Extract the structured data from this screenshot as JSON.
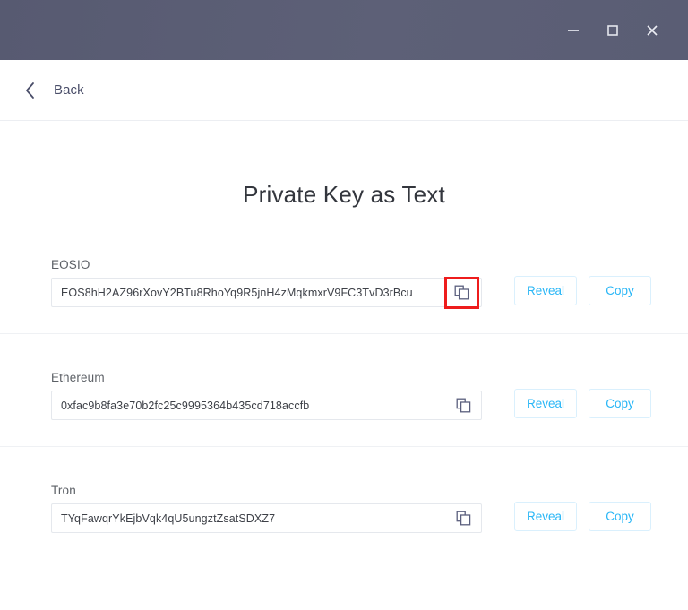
{
  "window": {
    "titlebar_color": "#5a5d74",
    "controls": [
      {
        "name": "minimize",
        "glyph": "minimize-icon"
      },
      {
        "name": "maximize",
        "glyph": "maximize-icon"
      },
      {
        "name": "close",
        "glyph": "close-icon"
      }
    ]
  },
  "nav": {
    "back_label": "Back",
    "back_icon": "chevron-left-icon"
  },
  "page": {
    "title": "Private Key as Text"
  },
  "accent": {
    "link_blue": "#29b6f6",
    "button_border": "#daf0fd",
    "highlight_red": "#ee1c1c"
  },
  "buttons": {
    "reveal_label": "Reveal",
    "copy_label": "Copy"
  },
  "rows": [
    {
      "label": "EOSIO",
      "value": "EOS8hH2AZ96rXovY2BTu8RhoYq9R5jnH4zMqkmxrV9FC3TvD3rBcu",
      "copy_icon": "copy-icon",
      "highlighted": true
    },
    {
      "label": "Ethereum",
      "value": "0xfac9b8fa3e70b2fc25c9995364b435cd718accfb",
      "copy_icon": "copy-icon",
      "highlighted": false
    },
    {
      "label": "Tron",
      "value": "TYqFawqrYkEjbVqk4qU5ungztZsatSDXZ7",
      "copy_icon": "copy-icon",
      "highlighted": false
    }
  ]
}
